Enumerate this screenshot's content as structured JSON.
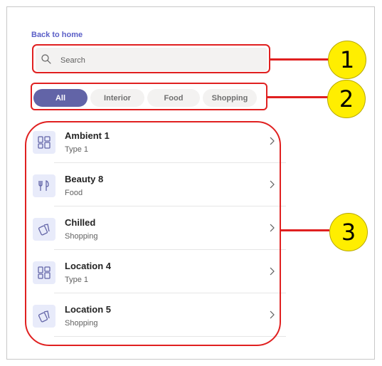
{
  "back_link": "Back to home",
  "search": {
    "placeholder": "Search",
    "value": ""
  },
  "filters": [
    {
      "label": "All",
      "active": true
    },
    {
      "label": "Interior",
      "active": false
    },
    {
      "label": "Food",
      "active": false
    },
    {
      "label": "Shopping",
      "active": false
    }
  ],
  "items": [
    {
      "title": "Ambient 1",
      "subtitle": "Type 1",
      "icon": "grid-icon"
    },
    {
      "title": "Beauty 8",
      "subtitle": "Food",
      "icon": "fork-knife-icon"
    },
    {
      "title": "Chilled",
      "subtitle": "Shopping",
      "icon": "shopping-tag-icon"
    },
    {
      "title": "Location 4",
      "subtitle": "Type 1",
      "icon": "grid-icon"
    },
    {
      "title": "Location 5",
      "subtitle": "Shopping",
      "icon": "shopping-tag-icon"
    }
  ],
  "callouts": [
    "1",
    "2",
    "3"
  ],
  "colors": {
    "accent": "#6264a7",
    "link": "#5b5fc7",
    "highlight": "#e02020",
    "badge": "#ffee00",
    "icon_tile": "#e8ebfa"
  }
}
